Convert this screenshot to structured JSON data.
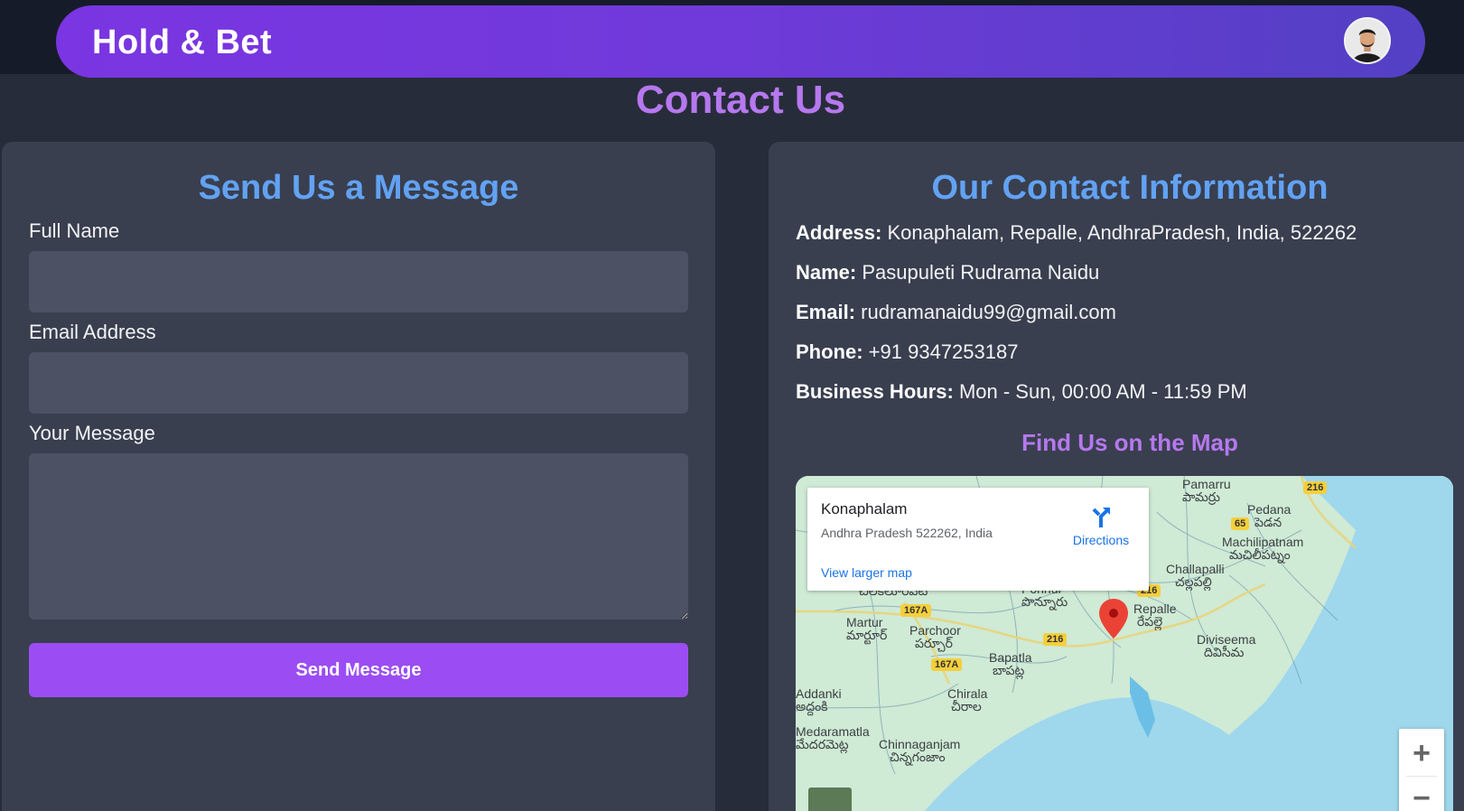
{
  "header": {
    "brand": "Hold & Bet",
    "avatar_icon": "user-avatar",
    "colors": {
      "gradient_start": "#7b35e2",
      "gradient_end": "#5340c4"
    }
  },
  "page": {
    "title": "Contact Us",
    "title_color": "#b678ee"
  },
  "form": {
    "title": "Send Us a Message",
    "fields": [
      {
        "label": "Full Name",
        "value": "",
        "placeholder": ""
      },
      {
        "label": "Email Address",
        "value": "",
        "placeholder": ""
      },
      {
        "label": "Your Message",
        "value": "",
        "placeholder": ""
      }
    ],
    "submit_label": "Send Message",
    "button_color": "#9b4df3"
  },
  "contact": {
    "title": "Our Contact Information",
    "rows": [
      {
        "label": "Address:",
        "value": " Konaphalam, Repalle, AndhraPradesh, India, 522262"
      },
      {
        "label": "Name:",
        "value": " Pasupuleti Rudrama Naidu"
      },
      {
        "label": "Email:",
        "value": " rudramanaidu99@gmail.com"
      },
      {
        "label": "Phone:",
        "value": " +91 9347253187"
      },
      {
        "label": "Business Hours:",
        "value": " Mon - Sun, 00:00 AM - 11:59 PM"
      }
    ],
    "map_heading": "Find Us on the Map"
  },
  "map": {
    "place_name": "Konaphalam",
    "place_address": "Andhra Pradesh 522262, India",
    "directions_label": "Directions",
    "larger_map_label": "View larger map",
    "zoom_in": "+",
    "zoom_out": "−",
    "labels": [
      {
        "text": "Pamarru"
      },
      {
        "text": "పామర్రు"
      },
      {
        "text": "Pedana"
      },
      {
        "text": "పెడన"
      },
      {
        "text": "Machilipatnam"
      },
      {
        "text": "మచిలీపట్నం"
      },
      {
        "text": "Challapalli"
      },
      {
        "text": "చల్లపల్లి"
      },
      {
        "text": "Repalle"
      },
      {
        "text": "రేపల్లె"
      },
      {
        "text": "Diviseema"
      },
      {
        "text": "దివిసీమ"
      },
      {
        "text": "Martur"
      },
      {
        "text": "మార్టూర్"
      },
      {
        "text": "Parchoor"
      },
      {
        "text": "పర్చూర్"
      },
      {
        "text": "Bapatla"
      },
      {
        "text": "బాపట్ల"
      },
      {
        "text": "Chirala"
      },
      {
        "text": "చీరాల"
      },
      {
        "text": "Addanki"
      },
      {
        "text": "అద్దంకి"
      },
      {
        "text": "Medaramatla"
      },
      {
        "text": "మేదరమెట్ల"
      },
      {
        "text": "Chinnaganjam"
      },
      {
        "text": "చిన్నగంజాం"
      },
      {
        "text": "Ponnur"
      },
      {
        "text": "పొన్నూరు"
      },
      {
        "text": "చిలకలూరిపేట"
      }
    ],
    "road_badges": [
      "216",
      "65",
      "216",
      "167A",
      "216",
      "167A"
    ]
  }
}
